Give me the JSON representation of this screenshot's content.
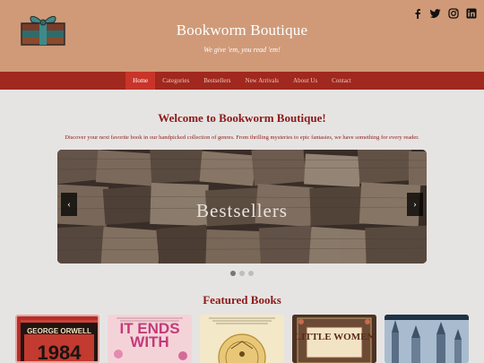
{
  "header": {
    "title": "Bookworm Boutique",
    "tagline": "We give 'em, you read 'em!",
    "logo_icon": "gift-books-icon",
    "social": [
      "facebook-icon",
      "twitter-icon",
      "instagram-icon",
      "linkedin-icon"
    ]
  },
  "nav": {
    "items": [
      "Home",
      "Categories",
      "Bestsellers",
      "New Arrivals",
      "About Us",
      "Contact"
    ],
    "active": "Home"
  },
  "welcome": {
    "title": "Welcome to Bookworm Boutique!",
    "text": "Discover your next favorite book in our handpicked collection of genres. From thrilling mysteries to epic fantasies, we have something for every reader."
  },
  "carousel": {
    "caption": "Bestsellers",
    "prev_label": "‹",
    "next_label": "›",
    "slide_count": 3,
    "active_slide": 1
  },
  "featured": {
    "title": "Featured Books",
    "books": [
      {
        "author": "GEORGE ORWELL",
        "title": "1984"
      },
      {
        "title": "IT ENDS WITH"
      },
      {
        "author": "",
        "title": ""
      },
      {
        "title": "LITTLE WOMEN"
      },
      {
        "title": ""
      }
    ]
  },
  "colors": {
    "header_bg": "#d09a78",
    "nav_bg": "#a0281e",
    "nav_active": "#c9342a",
    "accent": "#8b1a1a",
    "page_bg": "#e6e4e2"
  }
}
